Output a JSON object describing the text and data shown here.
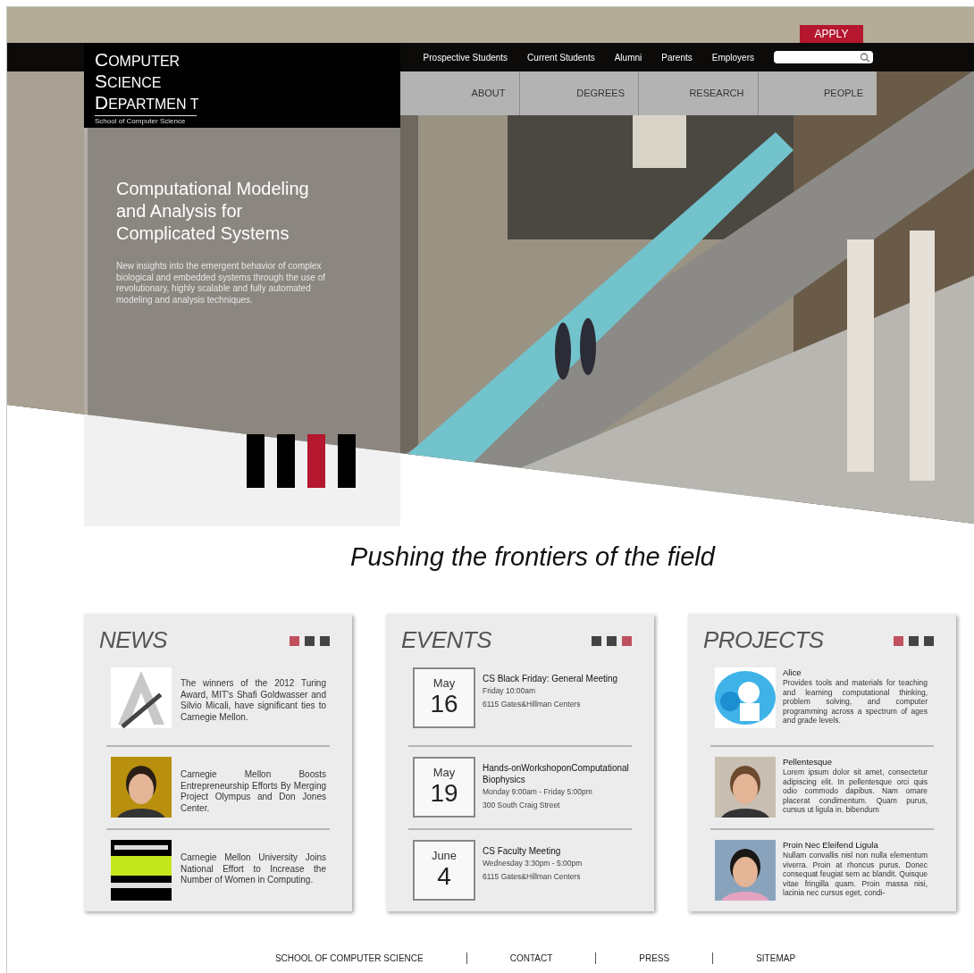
{
  "apply_button": "APPLY",
  "utility_nav": [
    "Prospective Students",
    "Current Students",
    "Alumni",
    "Parents",
    "Employers"
  ],
  "logo": {
    "lines": [
      "COMPUTER",
      "SCIENCE",
      "DEPARTMEN T"
    ],
    "subtitle": "School of Computer Science"
  },
  "main_nav": [
    "ABOUT",
    "DEGREES",
    "RESEARCH",
    "PEOPLE"
  ],
  "hero": {
    "title": "Computational Modeling and Analysis for Complicated Systems",
    "text": "New insights into the emergent behavior of complex biological and embedded systems through the use of revolutionary, highly scalable and fully automated modeling and analysis techniques."
  },
  "tagline": "Pushing the frontiers of the field",
  "sections": [
    {
      "kind": "news",
      "title": "NEWS",
      "pager": [
        {
          "selected": true
        },
        {
          "selected": false
        },
        {
          "selected": false
        }
      ],
      "items": [
        {
          "text": "The winners of the 2012 Turing Award, MIT's Shafi Goldwasser and Silvio Micali, have significant ties to Carnegie Mellon."
        },
        {
          "text": "Carnegie Mellon Boosts Entrepreneurship Efforts By Merging Project Olympus and Don Jones Center."
        },
        {
          "text": "Carnegie Mellon University Joins National Effort to Increase the Number of Women in Computing."
        }
      ]
    },
    {
      "kind": "events",
      "title": "EVENTS",
      "pager": [
        {
          "selected": false
        },
        {
          "selected": false
        },
        {
          "selected": true
        }
      ],
      "items": [
        {
          "month": "May",
          "day": "16",
          "title": "CS Black Friday: General Meeting",
          "time": "Friday 10:00am",
          "place": "6115 Gates&Hillman Centers"
        },
        {
          "month": "May",
          "day": "19",
          "title": "Hands-onWorkshoponComputational Biophysics",
          "time": "Monday 9:00am - Friday 5:00pm",
          "place": "300 South Craig Street"
        },
        {
          "month": "June",
          "day": "4",
          "title": "CS Faculty Meeting",
          "time": "Wednesday 3:30pm - 5:00pm",
          "place": "6115 Gates&Hillman Centers"
        }
      ]
    },
    {
      "kind": "projects",
      "title": "PROJECTS",
      "pager": [
        {
          "selected": true
        },
        {
          "selected": false
        },
        {
          "selected": false
        }
      ],
      "items": [
        {
          "title": "Alice",
          "text": "Provides tools and materials for teaching and learning computational thinking, problem solving, and computer programming across a spectrum of ages and grade levels."
        },
        {
          "title": "Pellentesque",
          "text": "Lorem ipsum dolor sit amet, consectetur adipiscing elit. In pellentesque orci quis odio commodo dapibus. Nam ornare placerat condimentum. Quam purus, cursus ut ligula in. bibendum"
        },
        {
          "title": "Proin Nec Eleifend Ligula",
          "text": "Nullam convallis nisl non nulla elementum viverra. Proin at rhoncus purus. Donec consequat feugiat sem ac blandit. Quisque vitae fringilla quam. Proin massa nisi, lacinia nec cursus eget, condi-"
        }
      ]
    }
  ],
  "footer_links": [
    "SCHOOL OF COMPUTER SCIENCE",
    "CONTACT",
    "PRESS",
    "SITEMAP"
  ]
}
